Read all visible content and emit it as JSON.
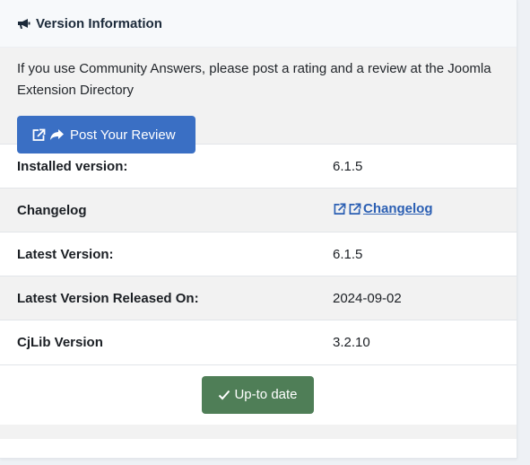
{
  "header": {
    "title": "Version Information",
    "icon": "megaphone-icon"
  },
  "intro": {
    "text": "If you use Community Answers, please post a rating and a review at the Joomla Extension Directory",
    "review_button_label": "Post Your Review"
  },
  "rows": [
    {
      "label": "Installed version:",
      "value": "6.1.5"
    },
    {
      "label": "Changelog",
      "value": "Changelog"
    },
    {
      "label": "Latest Version:",
      "value": "6.1.5"
    },
    {
      "label": "Latest Version Released On:",
      "value": "2024-09-02"
    },
    {
      "label": "CjLib Version",
      "value": "3.2.10"
    }
  ],
  "status_button_label": "Up-to date",
  "colors": {
    "primary_button": "#3a6fc4",
    "success_button": "#4f7e57",
    "link": "#2b5fb3"
  }
}
